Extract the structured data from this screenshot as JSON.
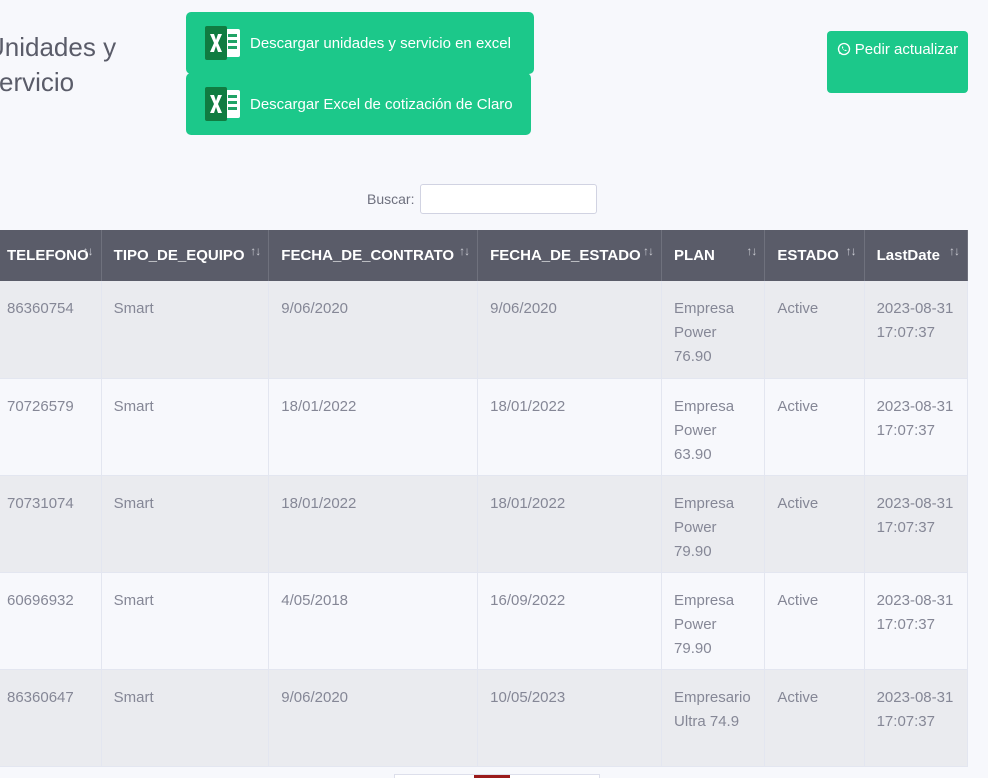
{
  "page": {
    "title": "Unidades y servicio"
  },
  "actions": {
    "download_units_label": "Descargar unidades y servicio en excel",
    "download_claro_label": "Descargar Excel de cotización de Claro",
    "refresh_label": "Pedir actualizar"
  },
  "search": {
    "label": "Buscar:",
    "value": ""
  },
  "colors": {
    "accent": "#1cc88a",
    "header_bg": "#5a5c69",
    "pager_active": "#9b1b1b"
  },
  "table": {
    "columns": [
      "TELEFONO",
      "TIPO_DE_EQUIPO",
      "FECHA_DE_CONTRATO",
      "FECHA_DE_ESTADO",
      "PLAN",
      "ESTADO",
      "LastDate"
    ],
    "rows": [
      [
        "86360754",
        "Smart",
        "9/06/2020",
        "9/06/2020",
        "Empresa Power 76.90",
        "Active",
        "2023-08-31 17:07:37"
      ],
      [
        "70726579",
        "Smart",
        "18/01/2022",
        "18/01/2022",
        "Empresa Power 63.90",
        "Active",
        "2023-08-31 17:07:37"
      ],
      [
        "70731074",
        "Smart",
        "18/01/2022",
        "18/01/2022",
        "Empresa Power 79.90",
        "Active",
        "2023-08-31 17:07:37"
      ],
      [
        "60696932",
        "Smart",
        "4/05/2018",
        "16/09/2022",
        "Empresa Power 79.90",
        "Active",
        "2023-08-31 17:07:37"
      ],
      [
        "86360647",
        "Smart",
        "9/06/2020",
        "10/05/2023",
        "Empresario Ultra 74.9",
        "Active",
        "2023-08-31 17:07:37"
      ]
    ]
  }
}
